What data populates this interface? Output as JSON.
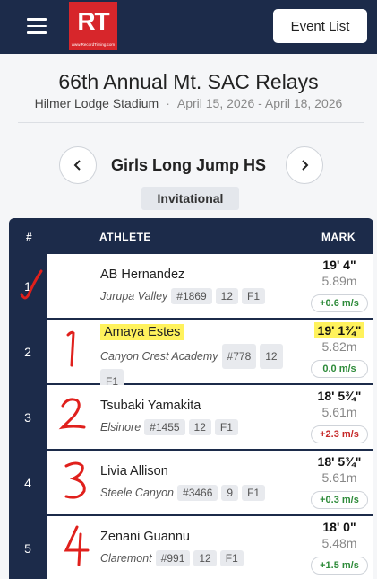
{
  "header": {
    "logo_text": "RT",
    "logo_sub": "www.RecordTiming.com",
    "event_list_label": "Event List"
  },
  "meet": {
    "title": "66th Annual Mt. SAC Relays",
    "venue": "Hilmer Lodge Stadium",
    "dates": "April 15, 2026 - April 18, 2026"
  },
  "event": {
    "name": "Girls Long Jump HS",
    "section": "Invitational"
  },
  "table": {
    "col_place": "#",
    "col_athlete": "ATHLETE",
    "col_mark": "MARK",
    "rows": [
      {
        "place": "1",
        "name": "AB Hernandez",
        "school": "Jurupa Valley",
        "bib": "#1869",
        "grade": "12",
        "flight": "F1",
        "mark_ft": "19' 4\"",
        "mark_m": "5.89m",
        "wind": "+0.6 m/s"
      },
      {
        "place": "2",
        "name": "Amaya Estes",
        "school": "Canyon Crest Academy",
        "bib": "#778",
        "grade": "12",
        "flight": "F1",
        "mark_ft": "19' 1¾\"",
        "mark_m": "5.82m",
        "wind": "0.0 m/s"
      },
      {
        "place": "3",
        "name": "Tsubaki Yamakita",
        "school": "Elsinore",
        "bib": "#1455",
        "grade": "12",
        "flight": "F1",
        "mark_ft": "18' 5¾\"",
        "mark_m": "5.61m",
        "wind": "+2.3 m/s"
      },
      {
        "place": "4",
        "name": "Livia Allison",
        "school": "Steele Canyon",
        "bib": "#3466",
        "grade": "9",
        "flight": "F1",
        "mark_ft": "18' 5¾\"",
        "mark_m": "5.61m",
        "wind": "+0.3 m/s"
      },
      {
        "place": "5",
        "name": "Zenani Guannu",
        "school": "Claremont",
        "bib": "#991",
        "grade": "12",
        "flight": "F1",
        "mark_ft": "18' 0\"",
        "mark_m": "5.48m",
        "wind": "+1.5 m/s"
      }
    ]
  },
  "colors": {
    "navy": "#1c2b4a",
    "brand_red": "#d7262b",
    "wind_positive": "#2e8b3a",
    "wind_negative": "#c62828",
    "highlight": "#fff25c",
    "annotation_red": "#e0201c"
  },
  "icons": {
    "menu": "hamburger-icon",
    "prev": "chevron-left-icon",
    "next": "chevron-right-icon"
  }
}
